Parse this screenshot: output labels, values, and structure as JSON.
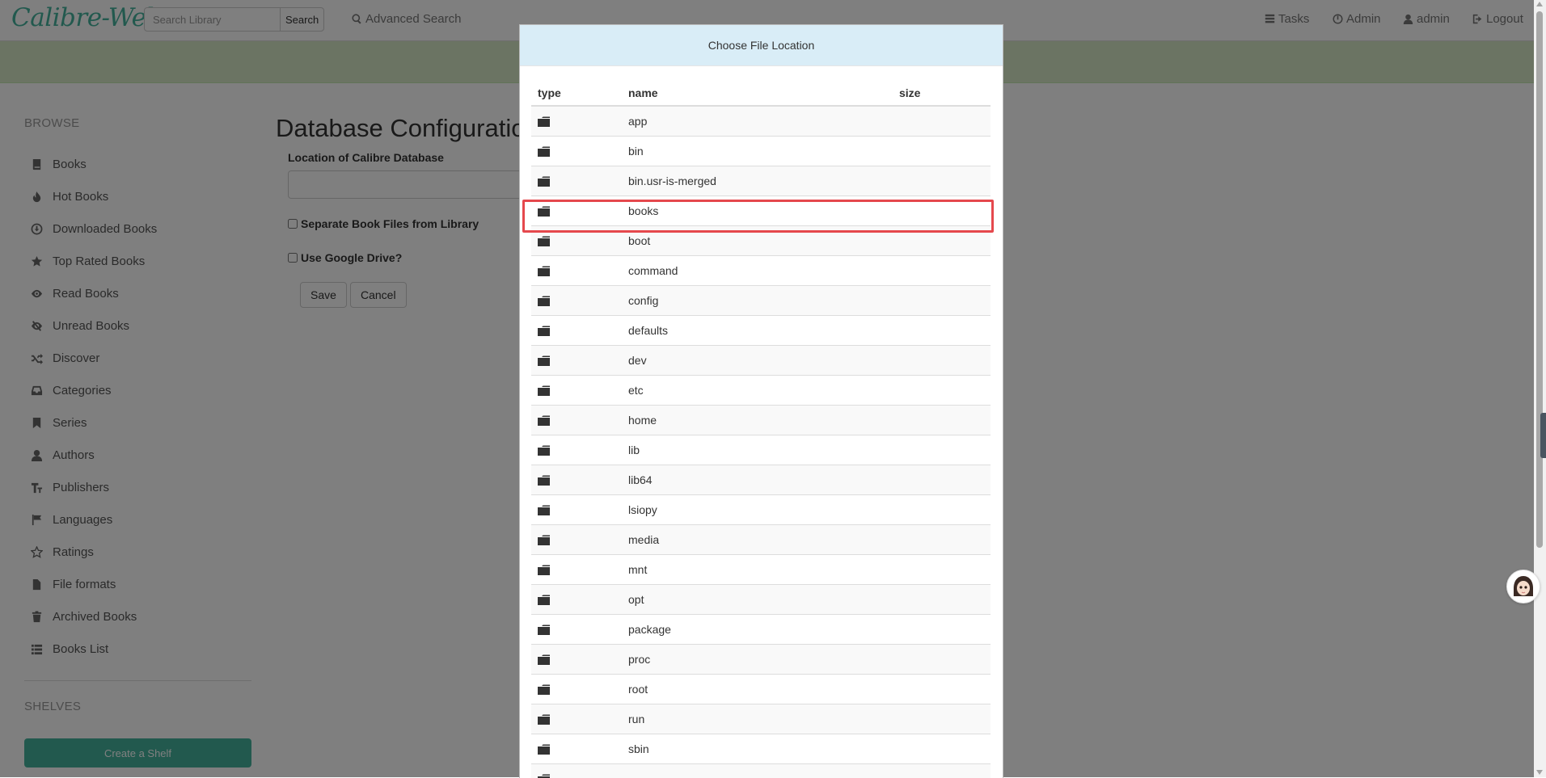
{
  "navbar": {
    "brand": "Calibre-Web",
    "search_placeholder": "Search Library",
    "search_button": "Search",
    "advanced_search": "Advanced Search",
    "tasks": "Tasks",
    "admin": "Admin",
    "user": "admin",
    "logout": "Logout"
  },
  "sidebar": {
    "browse_header": "BROWSE",
    "items": [
      {
        "label": "Books",
        "icon": "book-icon"
      },
      {
        "label": "Hot Books",
        "icon": "fire-icon"
      },
      {
        "label": "Downloaded Books",
        "icon": "download-icon"
      },
      {
        "label": "Top Rated Books",
        "icon": "star-icon"
      },
      {
        "label": "Read Books",
        "icon": "eye-open-icon"
      },
      {
        "label": "Unread Books",
        "icon": "eye-closed-icon"
      },
      {
        "label": "Discover",
        "icon": "shuffle-icon"
      },
      {
        "label": "Categories",
        "icon": "inbox-icon"
      },
      {
        "label": "Series",
        "icon": "bookmark-icon"
      },
      {
        "label": "Authors",
        "icon": "user-icon"
      },
      {
        "label": "Publishers",
        "icon": "text-size-icon"
      },
      {
        "label": "Languages",
        "icon": "flag-icon"
      },
      {
        "label": "Ratings",
        "icon": "star-empty-icon"
      },
      {
        "label": "File formats",
        "icon": "file-icon"
      },
      {
        "label": "Archived Books",
        "icon": "trash-icon"
      },
      {
        "label": "Books List",
        "icon": "list-icon"
      }
    ],
    "shelves_header": "SHELVES",
    "create_shelf": "Create a Shelf"
  },
  "main": {
    "title": "Database Configuration",
    "db_location_label": "Location of Calibre Database",
    "separate_files_label": "Separate Book Files from Library",
    "google_drive_label": "Use Google Drive?",
    "save": "Save",
    "cancel": "Cancel"
  },
  "modal": {
    "title": "Choose File Location",
    "columns": [
      "type",
      "name",
      "size"
    ],
    "rows": [
      {
        "name": "app",
        "size": ""
      },
      {
        "name": "bin",
        "size": ""
      },
      {
        "name": "bin.usr-is-merged",
        "size": ""
      },
      {
        "name": "books",
        "size": "",
        "highlighted": true
      },
      {
        "name": "boot",
        "size": ""
      },
      {
        "name": "command",
        "size": ""
      },
      {
        "name": "config",
        "size": ""
      },
      {
        "name": "defaults",
        "size": ""
      },
      {
        "name": "dev",
        "size": ""
      },
      {
        "name": "etc",
        "size": ""
      },
      {
        "name": "home",
        "size": ""
      },
      {
        "name": "lib",
        "size": ""
      },
      {
        "name": "lib64",
        "size": ""
      },
      {
        "name": "lsiopy",
        "size": ""
      },
      {
        "name": "media",
        "size": ""
      },
      {
        "name": "mnt",
        "size": ""
      },
      {
        "name": "opt",
        "size": ""
      },
      {
        "name": "package",
        "size": ""
      },
      {
        "name": "proc",
        "size": ""
      },
      {
        "name": "root",
        "size": ""
      },
      {
        "name": "run",
        "size": ""
      },
      {
        "name": "sbin",
        "size": ""
      },
      {
        "name": "",
        "size": ""
      }
    ]
  },
  "colors": {
    "brand": "#45b29d",
    "header_bg": "#d9edf7",
    "highlight": "#e5484d",
    "green_bar": "#d6e9c6"
  }
}
